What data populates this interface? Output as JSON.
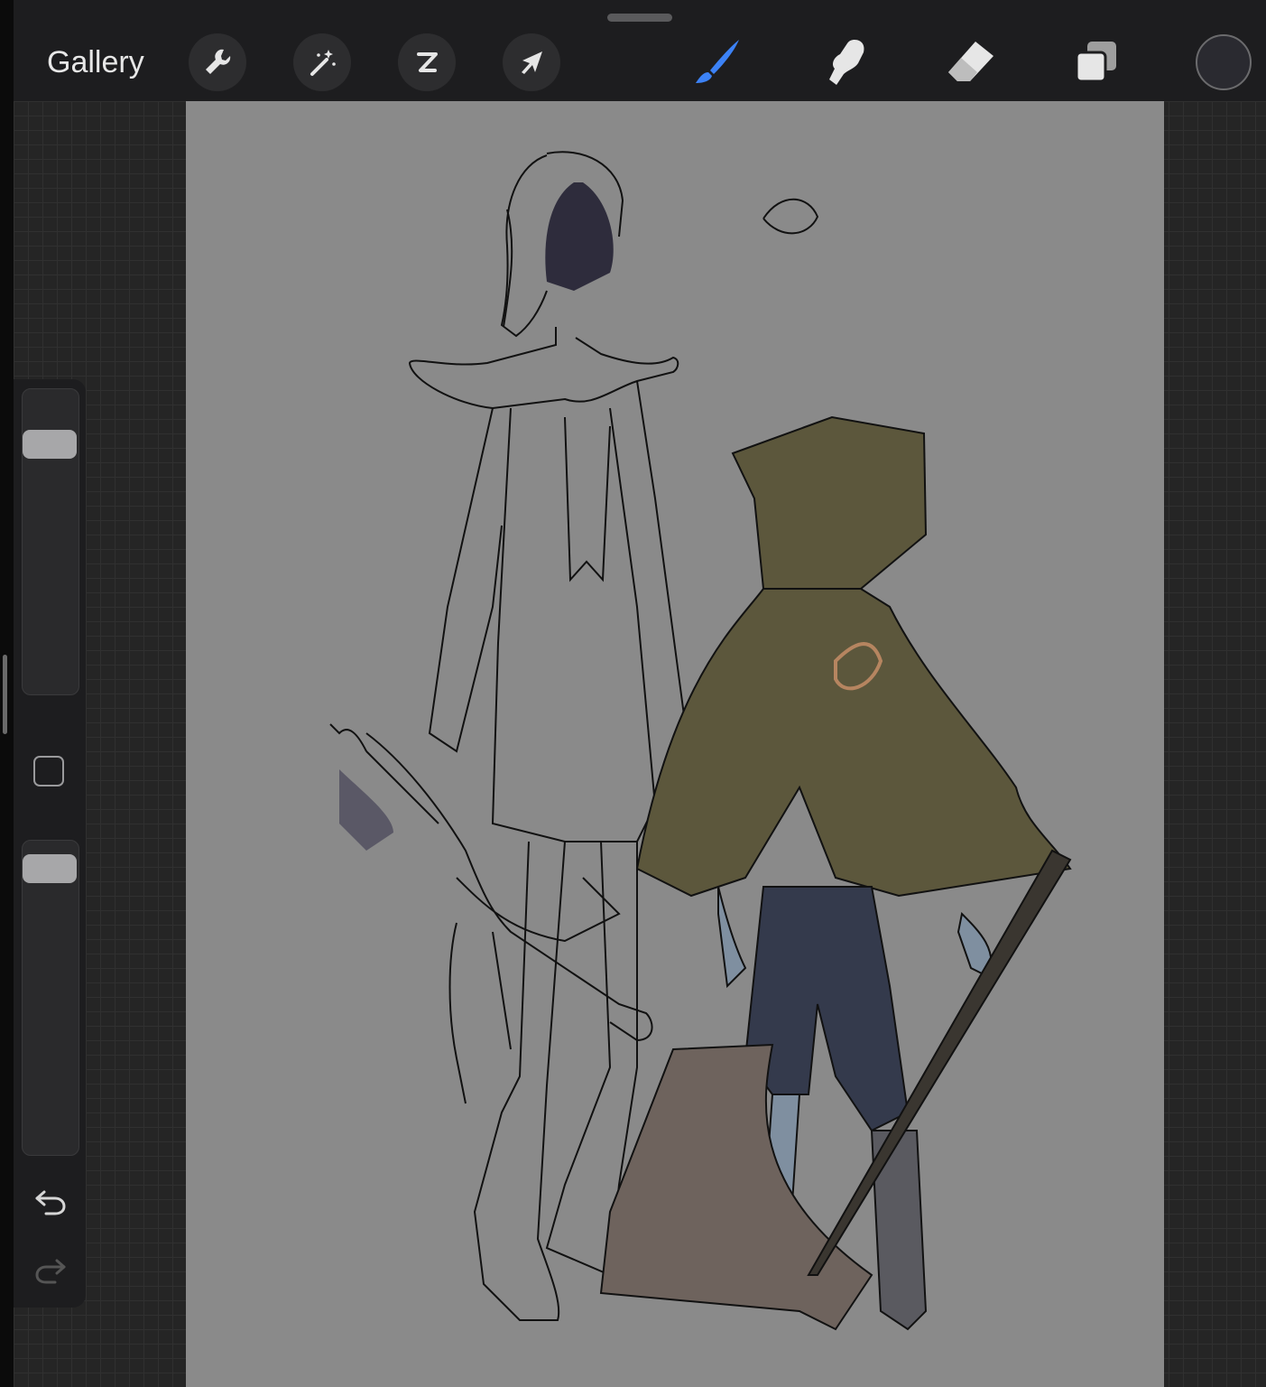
{
  "toolbar": {
    "gallery_label": "Gallery",
    "left_tools": [
      {
        "name": "actions",
        "icon": "wrench-icon"
      },
      {
        "name": "adjustments",
        "icon": "magic-wand-icon"
      },
      {
        "name": "selection",
        "icon": "selection-s-icon"
      },
      {
        "name": "transform",
        "icon": "arrow-cursor-icon"
      }
    ],
    "right_tools": [
      {
        "name": "brush",
        "icon": "brush-icon",
        "active": true
      },
      {
        "name": "smudge",
        "icon": "smudge-finger-icon",
        "active": false
      },
      {
        "name": "eraser",
        "icon": "eraser-icon",
        "active": false
      },
      {
        "name": "layers",
        "icon": "layers-icon",
        "active": false
      }
    ],
    "current_color": "#2a2a30"
  },
  "sidebar": {
    "brush_size_level": 0.85,
    "opacity_level": 0.95,
    "modify_icon": "square-icon",
    "undo_icon": "undo-icon",
    "redo_icon": "redo-icon"
  },
  "colors": {
    "active_tool": "#3c82f6",
    "tool_icon": "#e6e6e6",
    "canvas_bg": "#8a8a8a",
    "cloak": "#5c573c",
    "jeans": "#343a4c",
    "skin": "#7f8fa0",
    "axe_blade": "#6e635d"
  }
}
